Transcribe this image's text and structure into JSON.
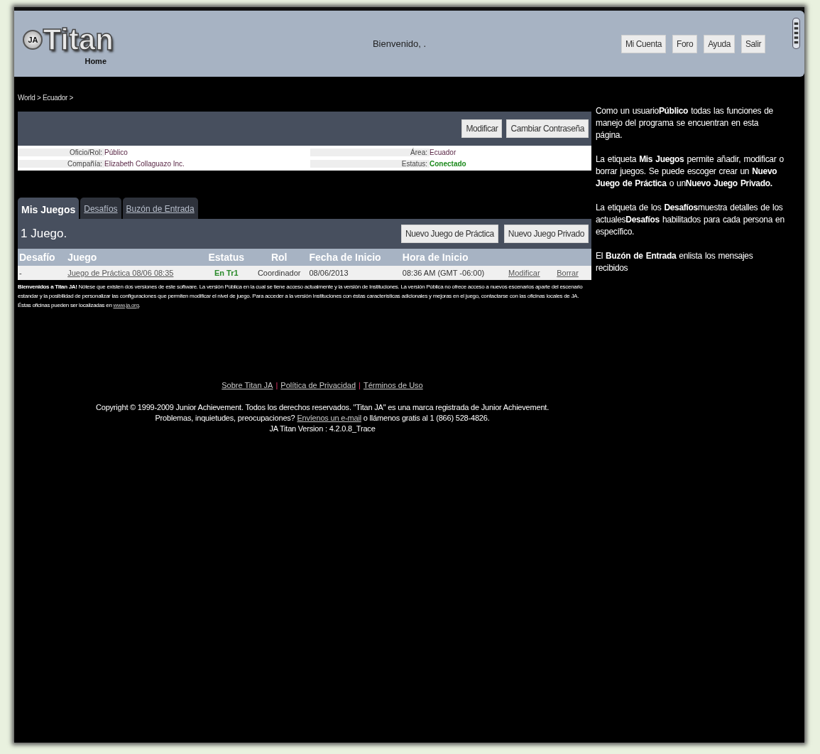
{
  "header": {
    "logo_badge": "JA",
    "logo": "Titan",
    "logo_sub": "Home",
    "greeting": "Bienvenido, .",
    "nav": [
      "Mi Cuenta",
      "Foro",
      "Ayuda",
      "Salir"
    ]
  },
  "breadcrumb": "World > Ecuador >",
  "account": {
    "buttons": [
      "Modificar",
      "Cambiar Contraseña"
    ],
    "fields": [
      {
        "label": "Oficio/Rol:",
        "value": "Público",
        "kind": "plain"
      },
      {
        "label": "Área:",
        "value": "Ecuador",
        "kind": "plain"
      },
      {
        "label": "Compañía:",
        "value": "Elizabeth Collaguazo Inc.",
        "kind": "plain"
      },
      {
        "label": "Estatus:",
        "value": "Conectado",
        "kind": "status"
      }
    ]
  },
  "tabs": [
    {
      "label": "Mis Juegos",
      "selected": true
    },
    {
      "label": "Desafíos",
      "selected": false
    },
    {
      "label": "Buzón de Entrada",
      "selected": false
    }
  ],
  "games": {
    "count": "1 Juego.",
    "buttons": [
      "Nuevo Juego de Práctica",
      "Nuevo Juego Privado"
    ],
    "columns": [
      "Desafío",
      "Juego",
      "Estatus",
      "Rol",
      "Fecha de Inicio",
      "Hora de Inicio"
    ],
    "rows": [
      {
        "challenge": "-",
        "game": "Juego de Práctica 08/06 08:35",
        "status": "En Tr1",
        "role": "Coordinador",
        "date": "08/06/2013",
        "time": "08:36 AM (GMT -06:00)",
        "actions": [
          "Modificar",
          "Borrar"
        ]
      }
    ]
  },
  "notice": {
    "text": "**Bienvenidos a Titan JA!** Nótese que existen dos versiones de este software. La versión Pública en la cual se tiene acceso actualmente y la versión de Instituciones. La versión Pública no ofrece acceso a nuevos escenarios aparte del escenario estandar y la posibilidad de personalizar las configuraciones que permiten modificar el nivel de juego. Para acceder a la versión Instituciones con éstas características adicionales y mejoras en el juego, contactarse con las oficinas locales de JA. Éstas oficinas pueden ser localizadas en ",
    "link": "www.ja.org",
    "after": "."
  },
  "footer": {
    "links": [
      "Sobre Titan JA",
      "Política de Privacidad",
      "Términos de Uso"
    ],
    "separator": "|",
    "copyright": "Copyright © 1999-2009 Junior Achievement. Todos los derechos reservados. \"Titan JA\" es una marca registrada de Junior Achievement.",
    "contact": {
      "before": "Problemas, inquietudes, preocupaciones? ",
      "link": "Envíenos un e-mail",
      "after": " o llámenos gratis al 1 (866) 528-4826."
    },
    "version": "JA Titan Version : 4.2.0.8_Trace"
  },
  "help": [
    "Como un usuario**Público** todas las funciones de manejo del programa se encuentran en esta página.",
    "La etiqueta **Mis Juegos** permite añadir, modificar o borrar juegos. Se puede escoger crear un **Nuevo Juego de Práctica** o un**Nuevo Juego Privado.**",
    "La etiqueta de los **Desafíos**muestra detalles de los actuales**Desafíos** habilitados para cada persona en específico.",
    "El **Buzón de Entrada** enlista los mensajes recibidos"
  ]
}
